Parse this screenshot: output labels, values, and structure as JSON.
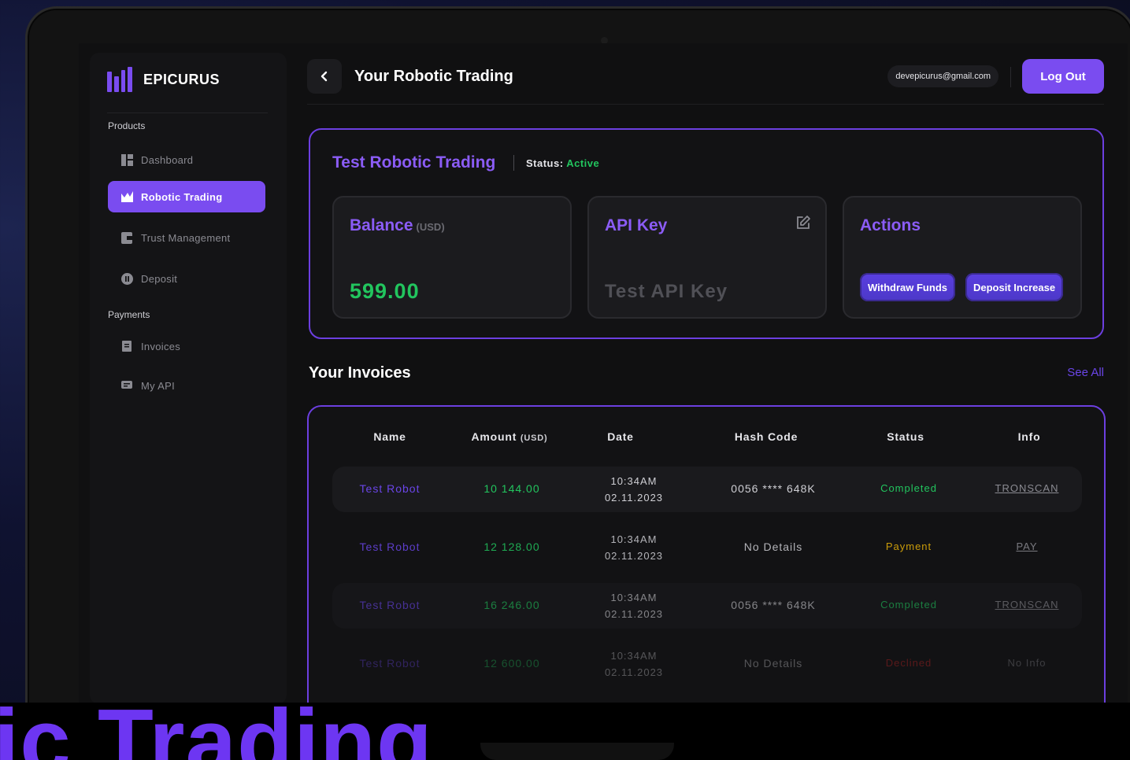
{
  "brand": {
    "name": "EPICURUS"
  },
  "sidebar": {
    "sections": [
      {
        "label": "Products"
      },
      {
        "label": "Payments"
      }
    ],
    "items": [
      {
        "label": "Dashboard",
        "icon": "dashboard-icon"
      },
      {
        "label": "Robotic Trading",
        "icon": "chart-icon",
        "active": true
      },
      {
        "label": "Trust Management",
        "icon": "document-icon"
      },
      {
        "label": "Deposit",
        "icon": "coin-icon"
      },
      {
        "label": "Invoices",
        "icon": "invoice-icon"
      },
      {
        "label": "My API",
        "icon": "api-icon"
      }
    ]
  },
  "header": {
    "title": "Your Robotic Trading",
    "email": "devepicurus@gmail.com",
    "logout_label": "Log Out"
  },
  "robot": {
    "name": "Test Robotic Trading",
    "status_label": "Status:",
    "status_value": "Active",
    "balance": {
      "title": "Balance",
      "unit": "(USD)",
      "value": "599.00"
    },
    "api_key": {
      "title": "API Key",
      "value": "Test API Key"
    },
    "actions": {
      "title": "Actions",
      "withdraw_label": "Withdraw Funds",
      "deposit_label": "Deposit Increase"
    }
  },
  "invoices": {
    "title": "Your Invoices",
    "see_all": "See All",
    "columns": {
      "name": "Name",
      "amount": "Amount",
      "amount_unit": "(USD)",
      "date": "Date",
      "hash": "Hash Code",
      "status": "Status",
      "info": "Info"
    },
    "rows": [
      {
        "name": "Test Robot",
        "amount": "10 144.00",
        "time": "10:34AM",
        "date": "02.11.2023",
        "hash": "0056 **** 648K",
        "status": "Completed",
        "info": "TRONSCAN"
      },
      {
        "name": "Test Robot",
        "amount": "12 128.00",
        "time": "10:34AM",
        "date": "02.11.2023",
        "hash": "No Details",
        "status": "Payment",
        "info": "PAY"
      },
      {
        "name": "Test Robot",
        "amount": "16 246.00",
        "time": "10:34AM",
        "date": "02.11.2023",
        "hash": "0056 **** 648K",
        "status": "Completed",
        "info": "TRONSCAN"
      },
      {
        "name": "Test Robot",
        "amount": "12 600.00",
        "time": "10:34AM",
        "date": "02.11.2023",
        "hash": "No Details",
        "status": "Declined",
        "info": "No Info"
      }
    ]
  },
  "overlay_text": "ic Trading",
  "colors": {
    "accent": "#7a4cf0",
    "green": "#22c55e",
    "yellow": "#eab308",
    "red": "#dc2626"
  }
}
